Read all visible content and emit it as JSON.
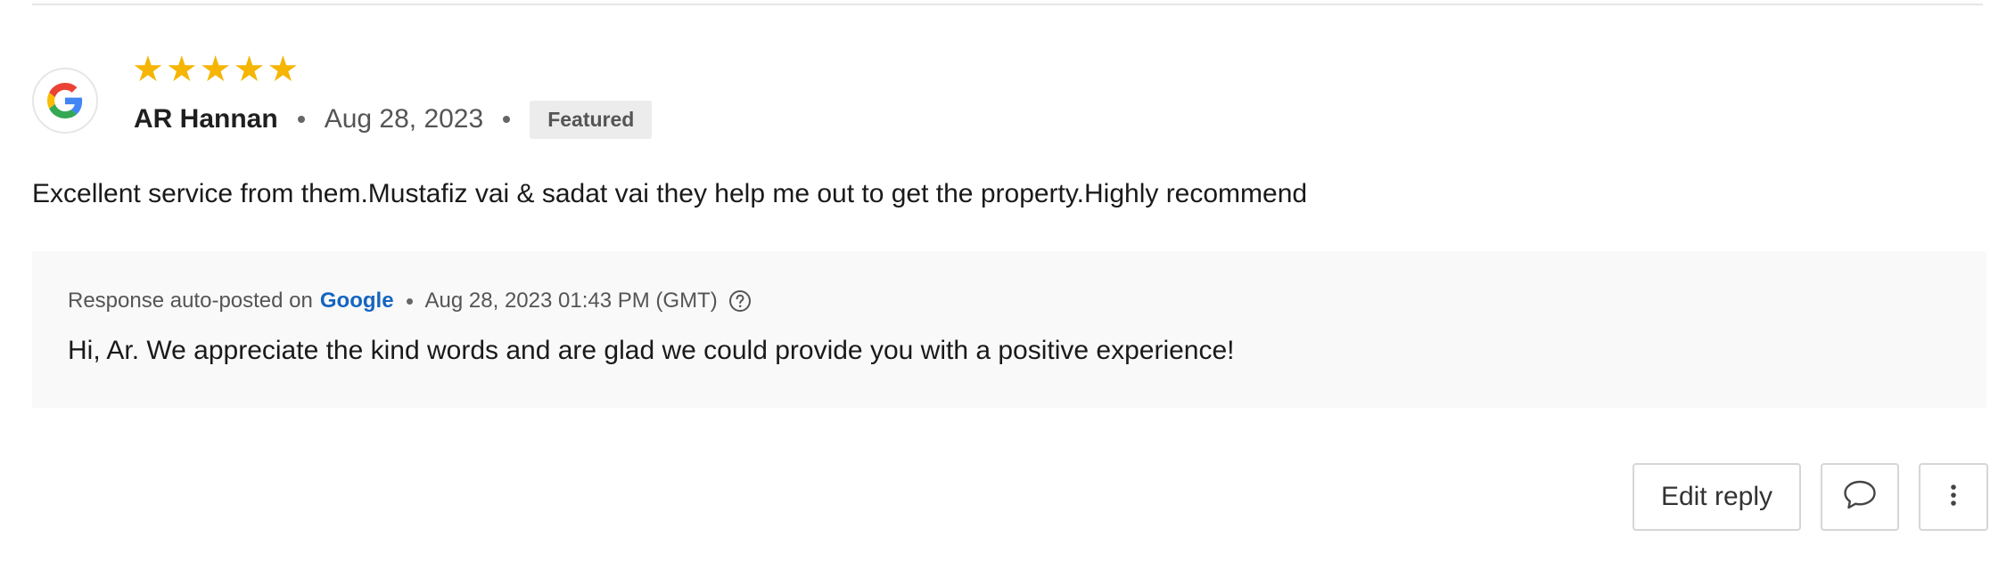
{
  "review": {
    "source_icon": "google-g-icon",
    "rating": 5,
    "stars": [
      "★",
      "★",
      "★",
      "★",
      "★"
    ],
    "reviewer_name": "AR Hannan",
    "date": "Aug 28, 2023",
    "badge": "Featured",
    "text": "Excellent service from them.Mustafiz vai & sadat vai they help me out to get the property.Highly recommend"
  },
  "response": {
    "prefix": "Response auto-posted on",
    "platform": "Google",
    "datetime": "Aug 28, 2023 01:43 PM (GMT)",
    "help_icon": "question-circle-icon",
    "text": "Hi, Ar. We appreciate the kind words and are glad we could provide you with a positive experience!"
  },
  "actions": {
    "edit_reply_label": "Edit reply",
    "comment_icon": "comment-bubble-icon",
    "more_icon": "more-vertical-icon"
  },
  "colors": {
    "star": "#f5b500",
    "link": "#1565c0",
    "badge_bg": "#ececec",
    "response_bg": "#f9f9f9"
  }
}
